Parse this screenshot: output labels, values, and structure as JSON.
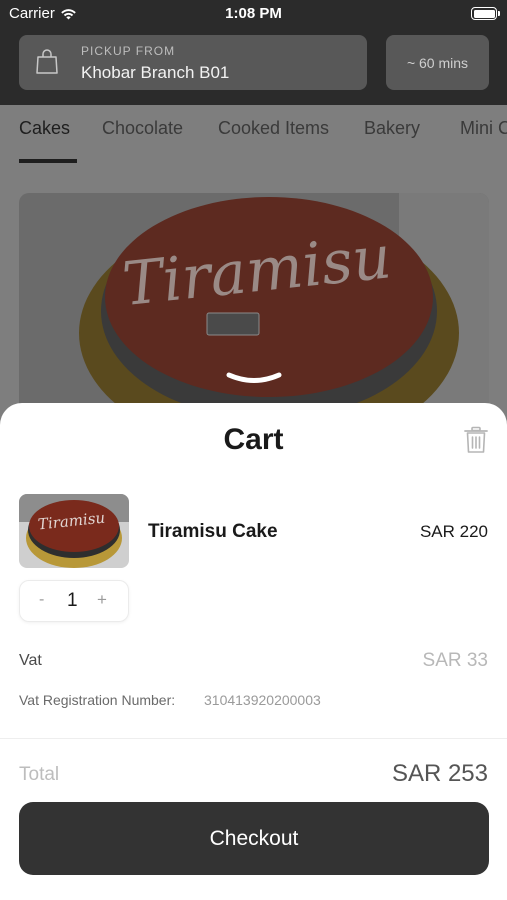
{
  "status_bar": {
    "carrier": "Carrier",
    "time": "1:08 PM"
  },
  "header": {
    "pickup_label": "PICKUP FROM",
    "branch": "Khobar Branch B01",
    "time_estimate": "~ 60 mins"
  },
  "tabs": [
    {
      "label": "Cakes",
      "active": true
    },
    {
      "label": "Chocolate",
      "active": false
    },
    {
      "label": "Cooked Items",
      "active": false
    },
    {
      "label": "Bakery",
      "active": false
    },
    {
      "label": "Mini C",
      "active": false
    }
  ],
  "product_image_text": "Tiramisu",
  "cart": {
    "title": "Cart",
    "item": {
      "name": "Tiramisu Cake",
      "price": "SAR 220",
      "quantity": "1",
      "minus": "-",
      "plus": "+"
    },
    "vat_label": "Vat",
    "vat_value": "SAR 33",
    "vat_reg_label": "Vat Registration Number:",
    "vat_reg_number": "310413920200003",
    "total_label": "Total",
    "total_value": "SAR 253",
    "checkout_label": "Checkout"
  },
  "colors": {
    "dark": "#2b2b2b",
    "box": "#585858",
    "overlay": "#7e7e7e",
    "button": "#333333",
    "cake": "#7a2a1c"
  }
}
